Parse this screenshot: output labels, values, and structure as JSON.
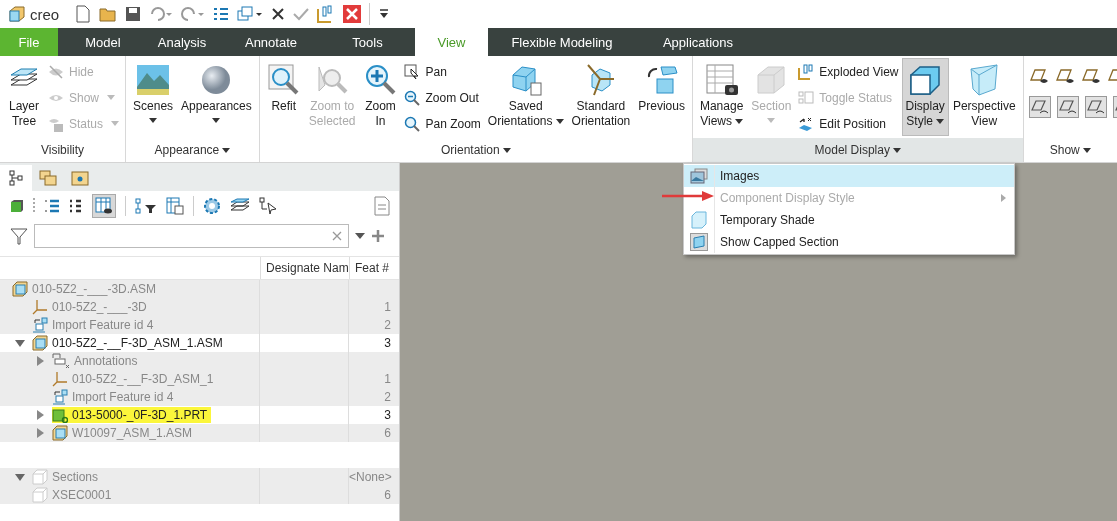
{
  "app": {
    "logo": "creo"
  },
  "tabs": [
    {
      "label": "File",
      "kind": "file",
      "selected": false
    },
    {
      "label": "Model",
      "kind": "tab",
      "selected": false
    },
    {
      "label": "Analysis",
      "kind": "tab",
      "selected": false
    },
    {
      "label": "Annotate",
      "kind": "tab",
      "selected": false
    },
    {
      "label": "Tools",
      "kind": "tab",
      "selected": false
    },
    {
      "label": "View",
      "kind": "tab",
      "selected": true
    },
    {
      "label": "Flexible Modeling",
      "kind": "tab",
      "selected": false
    },
    {
      "label": "Applications",
      "kind": "tab",
      "selected": false
    }
  ],
  "ribbon": [
    {
      "label": "Visibility",
      "menu": false,
      "active": false,
      "columns": [
        {
          "kind": "large",
          "label": "Layer\nTree",
          "disabled": false,
          "selected": false
        },
        {
          "kind": "stack",
          "items": [
            {
              "label": "Hide",
              "disabled": true,
              "caret": false
            },
            {
              "label": "Show",
              "disabled": true,
              "caret": true
            },
            {
              "label": "Status",
              "disabled": true,
              "caret": true
            }
          ]
        }
      ]
    },
    {
      "label": "Appearance",
      "menu": true,
      "active": false,
      "columns": [
        {
          "kind": "large",
          "label": "Scenes",
          "caret_below": true,
          "disabled": false,
          "selected": false
        },
        {
          "kind": "large",
          "label": "Appearances",
          "caret_below": true,
          "disabled": false,
          "selected": false
        }
      ]
    },
    {
      "label": "Orientation",
      "menu": true,
      "active": false,
      "columns": [
        {
          "kind": "large",
          "label": "Refit",
          "disabled": false,
          "selected": false
        },
        {
          "kind": "large",
          "label": "Zoom to\nSelected",
          "disabled": true,
          "selected": false
        },
        {
          "kind": "large",
          "label": "Zoom\nIn",
          "disabled": false,
          "selected": false
        },
        {
          "kind": "stack",
          "items": [
            {
              "label": "Pan",
              "disabled": false,
              "caret": false
            },
            {
              "label": "Zoom Out",
              "disabled": false,
              "caret": false
            },
            {
              "label": "Pan Zoom",
              "disabled": false,
              "caret": false
            }
          ]
        },
        {
          "kind": "large",
          "label": "Saved\nOrientations",
          "caret_inline": true,
          "disabled": false,
          "selected": false
        },
        {
          "kind": "large",
          "label": "Standard\nOrientation",
          "disabled": false,
          "selected": false
        },
        {
          "kind": "large",
          "label": "Previous",
          "disabled": false,
          "selected": false
        }
      ]
    },
    {
      "label": "Model Display",
      "menu": true,
      "active": true,
      "columns": [
        {
          "kind": "large",
          "label": "Manage\nViews",
          "caret_inline": true,
          "disabled": false,
          "selected": false
        },
        {
          "kind": "large",
          "label": "Section",
          "caret_below": true,
          "disabled": true,
          "selected": false
        },
        {
          "kind": "stack",
          "items": [
            {
              "label": "Exploded View",
              "disabled": false,
              "caret": false
            },
            {
              "label": "Toggle Status",
              "disabled": true,
              "caret": false
            },
            {
              "label": "Edit Position",
              "disabled": false,
              "caret": false
            }
          ]
        },
        {
          "kind": "large",
          "label": "Display\nStyle",
          "caret_inline": true,
          "disabled": false,
          "selected": true
        },
        {
          "kind": "large",
          "label": "Perspective\nView",
          "disabled": false,
          "selected": false
        }
      ]
    },
    {
      "label": "Show",
      "menu": true,
      "active": false,
      "columns": [
        {
          "kind": "icongrid"
        }
      ]
    }
  ],
  "panel": {
    "columns": [
      "Designate Nam",
      "Feat #"
    ],
    "tree": [
      {
        "name": "010-5Z2_-___-3D.ASM",
        "kind": "assembly",
        "dimmed": true,
        "highlighted": false,
        "children": [
          {
            "name": "010-5Z2_-___-3D",
            "feat": "1",
            "kind": "datum",
            "dimmed": true,
            "highlighted": false
          },
          {
            "name": "Import Feature id 4",
            "feat": "2",
            "kind": "import",
            "dimmed": true,
            "highlighted": false
          }
        ]
      },
      {
        "name": "010-5Z2_-__F-3D_ASM_1.ASM",
        "feat": "3",
        "kind": "assembly",
        "dimmed": false,
        "highlighted": false,
        "expanded": true,
        "children": [
          {
            "name": "Annotations",
            "kind": "annotation",
            "dimmed": true,
            "highlighted": false,
            "expanded": false
          },
          {
            "name": "010-5Z2_-__F-3D_ASM_1",
            "feat": "1",
            "kind": "datum",
            "dimmed": true,
            "highlighted": false
          },
          {
            "name": "Import Feature id 4",
            "feat": "2",
            "kind": "import",
            "dimmed": true,
            "highlighted": false
          },
          {
            "name": "013-5000-_0F-3D_1.PRT",
            "feat": "3",
            "kind": "part",
            "dimmed": false,
            "highlighted": true,
            "expanded": false
          },
          {
            "name": "W10097_ASM_1.ASM",
            "feat": "6",
            "kind": "assembly",
            "dimmed": true,
            "highlighted": false,
            "expanded": false
          }
        ]
      }
    ],
    "sections": [
      {
        "name": "Sections",
        "feat": "<None>",
        "kind": "section",
        "dimmed": true,
        "highlighted": false,
        "expanded": true,
        "children": [
          {
            "name": "XSEC0001",
            "feat": "6",
            "kind": "section",
            "dimmed": true,
            "highlighted": false
          }
        ]
      }
    ]
  },
  "menu": [
    {
      "label": "Images",
      "selected": true,
      "disabled": false,
      "submenu": false
    },
    {
      "label": "Component Display Style",
      "selected": false,
      "disabled": true,
      "submenu": true
    },
    {
      "label": "Temporary Shade",
      "selected": false,
      "disabled": false,
      "submenu": false
    },
    {
      "label": "Show Capped Section",
      "selected": false,
      "disabled": false,
      "submenu": false
    }
  ]
}
